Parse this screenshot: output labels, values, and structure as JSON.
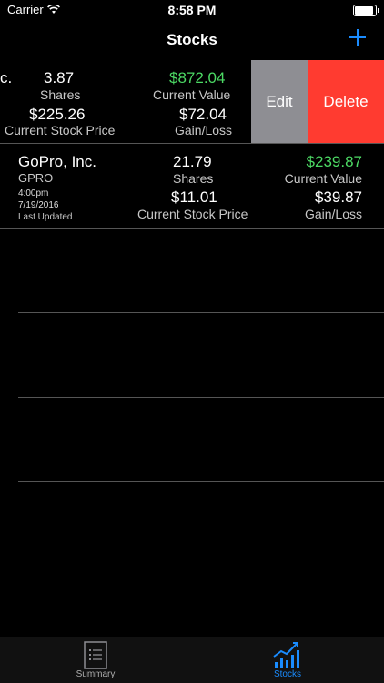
{
  "status": {
    "carrier": "Carrier",
    "time": "8:58 PM",
    "battery": 1.0
  },
  "nav": {
    "title": "Stocks"
  },
  "rows": [
    {
      "name_fragment": "c.",
      "shares": "3.87",
      "shares_label": "Shares",
      "value": "$872.04",
      "value_label": "Current Value",
      "price": "$225.26",
      "price_label": "Current Stock Price",
      "gain": "$72.04",
      "gain_label": "Gain/Loss",
      "edit_label": "Edit",
      "delete_label": "Delete"
    },
    {
      "name": "GoPro, Inc.",
      "ticker": "GPRO",
      "updated_time": "4:00pm",
      "updated_date": "7/19/2016",
      "updated_label": "Last Updated",
      "shares": "21.79",
      "shares_label": "Shares",
      "value": "$239.87",
      "value_label": "Current Value",
      "price": "$11.01",
      "price_label": "Current Stock Price",
      "gain": "$39.87",
      "gain_label": "Gain/Loss"
    }
  ],
  "tabs": [
    {
      "label": "Summary",
      "icon": "document-list-icon",
      "active": false
    },
    {
      "label": "Stocks",
      "icon": "chart-growth-icon",
      "active": true
    }
  ],
  "colors": {
    "accent": "#1a8cff",
    "positive": "#4cd964",
    "delete": "#ff3b30",
    "edit": "#8e8e93"
  }
}
